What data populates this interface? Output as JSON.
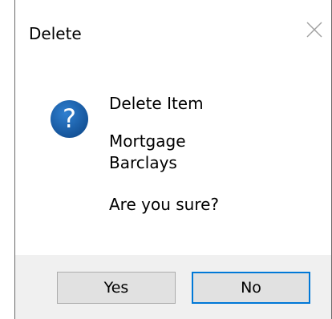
{
  "window": {
    "title": "Delete",
    "close_icon": "close-icon"
  },
  "message": {
    "icon": "question-icon",
    "heading": "Delete Item",
    "item_line1": "Mortgage",
    "item_line2": "Barclays",
    "prompt": "Are you sure?"
  },
  "buttons": {
    "yes_label": "Yes",
    "no_label": "No"
  },
  "colors": {
    "icon_blue": "#1a5fa8",
    "focus_border": "#0078d7",
    "footer_bg": "#f0f0f0",
    "button_bg": "#e1e1e1"
  }
}
